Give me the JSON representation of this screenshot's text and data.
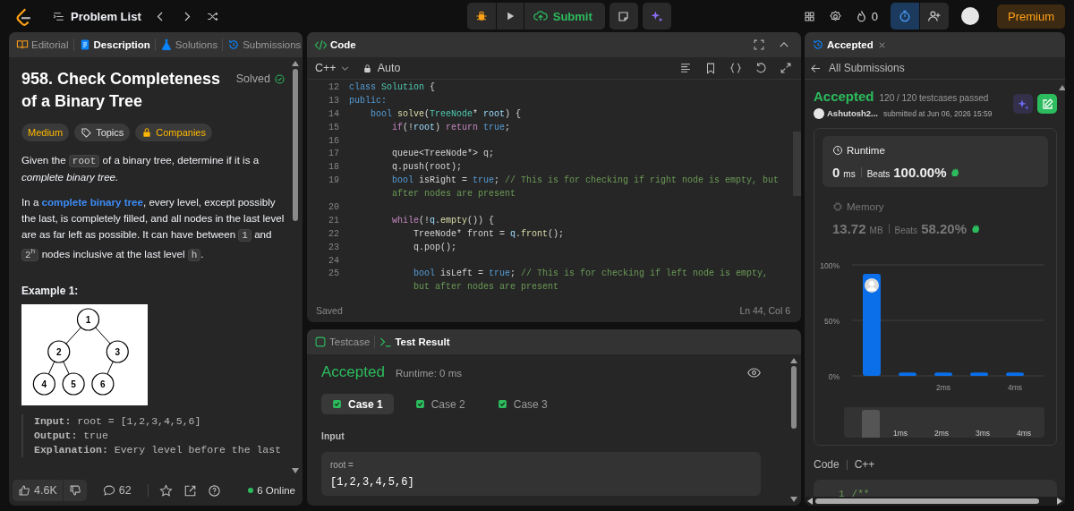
{
  "topbar": {
    "problem_list": "Problem List",
    "submit": "Submit",
    "streak": "0",
    "premium": "Premium"
  },
  "left_tabs": [
    {
      "label": "Editorial",
      "kind": "editorial",
      "selected": false
    },
    {
      "label": "Description",
      "kind": "description",
      "selected": true
    },
    {
      "label": "Solutions",
      "kind": "solutions",
      "selected": false
    },
    {
      "label": "Submissions",
      "kind": "submissions",
      "selected": false
    }
  ],
  "problem": {
    "title": "958. Check Completeness of a Binary Tree",
    "status": "Solved",
    "tags": [
      {
        "label": "Medium",
        "kind": "difficulty"
      },
      {
        "label": "Topics",
        "kind": "topics"
      },
      {
        "label": "Companies",
        "kind": "companies"
      }
    ],
    "paragraphs": [
      [
        {
          "kind": "text",
          "text": "Given the "
        },
        {
          "kind": "code",
          "text": "root"
        },
        {
          "kind": "text",
          "text": " of a binary tree, determine if it is a "
        },
        {
          "kind": "italic",
          "text": "complete binary tree."
        }
      ],
      [
        {
          "kind": "text",
          "text": "In a "
        },
        {
          "kind": "link",
          "text": "complete binary tree"
        },
        {
          "kind": "text",
          "text": ", every level, except possibly the last, is completely filled, and all nodes in the last level are as far left as possible. It can have between "
        },
        {
          "kind": "code",
          "text": "1"
        },
        {
          "kind": "text",
          "text": " and "
        },
        {
          "kind": "code",
          "text": "2$^{h}$"
        },
        {
          "kind": "text",
          "text": " nodes inclusive at the last level "
        },
        {
          "kind": "code",
          "text": "h"
        },
        {
          "kind": "text",
          "text": "."
        }
      ]
    ],
    "example": {
      "heading": "Example 1:",
      "tree": {
        "label": "1",
        "children": [
          {
            "label": "2",
            "children": [
              {
                "label": "4"
              },
              {
                "label": "5"
              }
            ]
          },
          {
            "label": "3",
            "children": [
              {
                "label": "6"
              }
            ]
          }
        ]
      },
      "lines": [
        "**Input:** root = [1,2,3,4,5,6]",
        "**Output:** true",
        "**Explanation:** Every level before the last"
      ]
    }
  },
  "left_footer": {
    "likes": "4.6K",
    "comments": "62",
    "online": "6 Online"
  },
  "code_panel": {
    "title": "Code",
    "language": "C++",
    "mode": "Auto",
    "status": "Saved",
    "cursor": "Ln 44, Col 6",
    "rows": [
      {
        "num": "12",
        "tokens": [
          {
            "kind": "kw",
            "text": "class "
          },
          {
            "kind": "type",
            "text": "Solution"
          },
          {
            "kind": "plain",
            "text": " {"
          }
        ]
      },
      {
        "num": "13",
        "tokens": [
          {
            "kind": "kw",
            "text": "public:"
          }
        ]
      },
      {
        "num": "14",
        "tokens": [
          {
            "kind": "kw",
            "text": "    bool "
          },
          {
            "kind": "fn",
            "text": "solve"
          },
          {
            "kind": "plain",
            "text": "("
          },
          {
            "kind": "type",
            "text": "TreeNode"
          },
          {
            "kind": "plain",
            "text": "* "
          },
          {
            "kind": "var",
            "text": "root"
          },
          {
            "kind": "plain",
            "text": ") {"
          }
        ]
      },
      {
        "num": "15",
        "tokens": [
          {
            "kind": "ctrl",
            "text": "        if"
          },
          {
            "kind": "plain",
            "text": "(!"
          },
          {
            "kind": "var",
            "text": "root"
          },
          {
            "kind": "plain",
            "text": ") "
          },
          {
            "kind": "ctrl",
            "text": "return "
          },
          {
            "kind": "kw",
            "text": "true"
          },
          {
            "kind": "plain",
            "text": ";"
          }
        ]
      },
      {
        "num": "16"
      },
      {
        "num": "17",
        "tokens": [
          {
            "kind": "plain",
            "text": "        queue<TreeNode*> q;"
          }
        ]
      },
      {
        "num": "18",
        "tokens": [
          {
            "kind": "plain",
            "text": "        q.push(root);"
          }
        ]
      },
      {
        "num": "19",
        "tokens": [
          {
            "kind": "kw",
            "text": "        bool"
          },
          {
            "kind": "plain",
            "text": " isRight = "
          },
          {
            "kind": "kw",
            "text": "true"
          },
          {
            "kind": "plain",
            "text": "; "
          },
          {
            "kind": "cmt",
            "text": "// This is for checking if right node is empty, but"
          }
        ]
      },
      {
        "tokens": [
          {
            "kind": "cmt",
            "text": "        after nodes are present"
          }
        ]
      },
      {
        "num": "20"
      },
      {
        "num": "21",
        "tokens": [
          {
            "kind": "ctrl",
            "text": "        while"
          },
          {
            "kind": "plain",
            "text": "(!"
          },
          {
            "kind": "var",
            "text": "q"
          },
          {
            "kind": "plain",
            "text": "."
          },
          {
            "kind": "fn",
            "text": "empty"
          },
          {
            "kind": "plain",
            "text": "()) {"
          }
        ]
      },
      {
        "num": "22",
        "tokens": [
          {
            "kind": "plain",
            "text": "            TreeNode* front = "
          },
          {
            "kind": "var",
            "text": "q"
          },
          {
            "kind": "plain",
            "text": "."
          },
          {
            "kind": "fn",
            "text": "front"
          },
          {
            "kind": "plain",
            "text": "();"
          }
        ]
      },
      {
        "num": "23",
        "tokens": [
          {
            "kind": "plain",
            "text": "            q.pop();"
          }
        ]
      },
      {
        "num": "24"
      },
      {
        "num": "25",
        "tokens": [
          {
            "kind": "kw",
            "text": "            bool"
          },
          {
            "kind": "plain",
            "text": " isLeft = "
          },
          {
            "kind": "kw",
            "text": "true"
          },
          {
            "kind": "plain",
            "text": "; "
          },
          {
            "kind": "cmt",
            "text": "// This is for checking if left node is empty,"
          }
        ]
      },
      {
        "tokens": [
          {
            "kind": "cmt",
            "text": "            but after nodes are present"
          }
        ]
      }
    ]
  },
  "test": {
    "tabs": [
      {
        "label": "Testcase",
        "kind": "testcase",
        "selected": false
      },
      {
        "label": "Test Result",
        "kind": "result",
        "selected": true
      }
    ],
    "verdict": "Accepted",
    "runtime": "Runtime: 0 ms",
    "cases": [
      {
        "label": "Case 1",
        "selected": true,
        "passed": true
      },
      {
        "label": "Case 2",
        "selected": false,
        "passed": true
      },
      {
        "label": "Case 3",
        "selected": false,
        "passed": true
      }
    ],
    "input_label": "Input",
    "input_name": "root =",
    "input_value": "[1,2,3,4,5,6]"
  },
  "submission": {
    "tab": "Accepted",
    "back": "All Submissions",
    "verdict": "Accepted",
    "passed": "120 / 120 testcases passed",
    "user": "Ashutosh2...",
    "submitted": "submitted at Jun 06, 2026 15:59",
    "stats": [
      {
        "kind": "runtime",
        "label": "Runtime",
        "value": "0",
        "unit": "ms",
        "beats_label": "Beats",
        "beats": "100.00%",
        "selected": true
      },
      {
        "kind": "memory",
        "label": "Memory",
        "value": "13.72",
        "unit": "MB",
        "beats_label": "Beats",
        "beats": "58.20%",
        "selected": false
      }
    ],
    "chart_data": {
      "type": "bar",
      "categories": [
        null,
        null,
        "2ms",
        null,
        "4ms"
      ],
      "values": [
        92,
        3,
        3,
        3,
        3
      ],
      "ylim": [
        0,
        100
      ],
      "yticks": [
        {
          "value": 0,
          "label": "0%"
        },
        {
          "value": 50,
          "label": "50%"
        },
        {
          "value": 100,
          "label": "100%"
        }
      ]
    },
    "overview_labels": [
      "1ms",
      "2ms",
      "3ms",
      "4ms"
    ],
    "code_label": "Code",
    "code_language": "C++",
    "code_line": {
      "num": "1",
      "text": "/**"
    }
  }
}
